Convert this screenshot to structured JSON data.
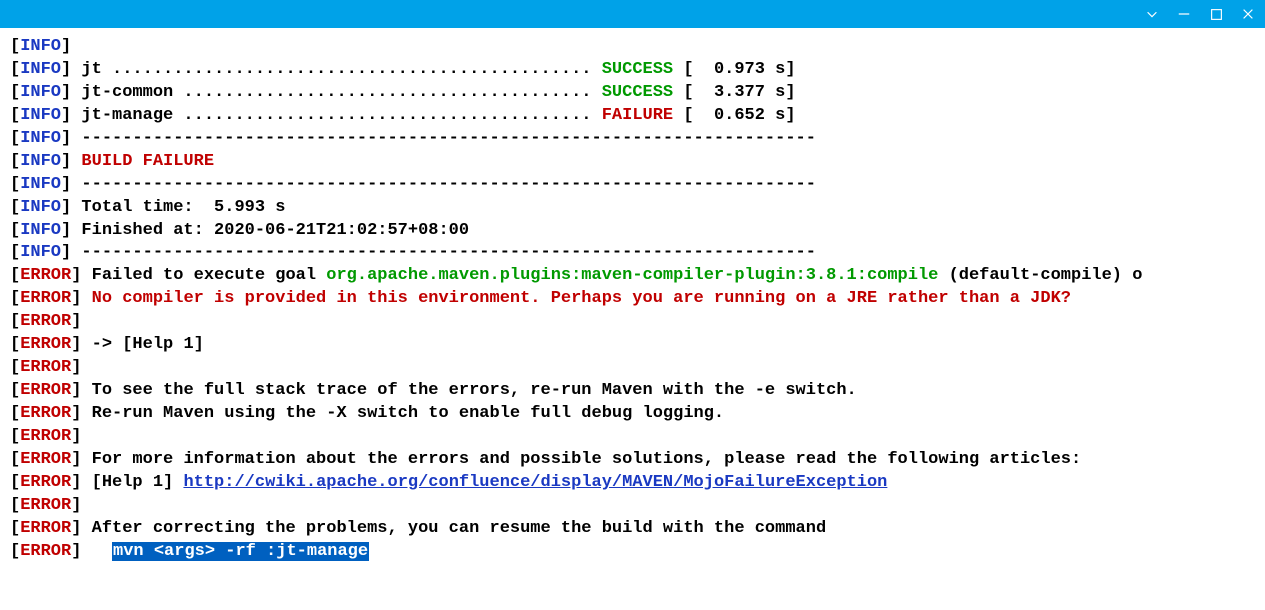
{
  "colors": {
    "titlebar_bg": "#00a2e8",
    "info": "#1a39c2",
    "error": "#c00000",
    "success": "#009900",
    "highlight_bg": "#0060c0"
  },
  "build": {
    "modules": [
      {
        "name": "jt",
        "status": "SUCCESS",
        "time": "0.973 s"
      },
      {
        "name": "jt-common",
        "status": "SUCCESS",
        "time": "3.377 s"
      },
      {
        "name": "jt-manage",
        "status": "FAILURE",
        "time": "0.652 s"
      }
    ],
    "result": "BUILD FAILURE",
    "total_time": "5.993 s",
    "finished_at": "2020-06-21T21:02:57+08:00"
  },
  "lines": [
    {
      "tag": "INFO",
      "parts": []
    },
    {
      "tag": "INFO",
      "parts": [
        {
          "t": " jt ............................................... ",
          "cls": "plain"
        },
        {
          "t": "SUCCESS",
          "cls": "green"
        },
        {
          "t": " [  0.973 s]",
          "cls": "plain"
        }
      ]
    },
    {
      "tag": "INFO",
      "parts": [
        {
          "t": " jt-common ........................................ ",
          "cls": "plain"
        },
        {
          "t": "SUCCESS",
          "cls": "green"
        },
        {
          "t": " [  3.377 s]",
          "cls": "plain"
        }
      ]
    },
    {
      "tag": "INFO",
      "parts": [
        {
          "t": " jt-manage ........................................ ",
          "cls": "plain"
        },
        {
          "t": "FAILURE",
          "cls": "red"
        },
        {
          "t": " [  0.652 s]",
          "cls": "plain"
        }
      ]
    },
    {
      "tag": "INFO",
      "parts": [
        {
          "t": " ------------------------------------------------------------------------",
          "cls": "plain bold"
        }
      ]
    },
    {
      "tag": "INFO",
      "parts": [
        {
          "t": " BUILD FAILURE",
          "cls": "red bold"
        }
      ]
    },
    {
      "tag": "INFO",
      "parts": [
        {
          "t": " ------------------------------------------------------------------------",
          "cls": "plain bold"
        }
      ]
    },
    {
      "tag": "INFO",
      "parts": [
        {
          "t": " Total time:  5.993 s",
          "cls": "plain"
        }
      ]
    },
    {
      "tag": "INFO",
      "parts": [
        {
          "t": " Finished at: 2020-06-21T21:02:57+08:00",
          "cls": "plain"
        }
      ]
    },
    {
      "tag": "INFO",
      "parts": [
        {
          "t": " ------------------------------------------------------------------------",
          "cls": "plain bold"
        }
      ]
    },
    {
      "tag": "ERROR",
      "parts": [
        {
          "t": " Failed to execute goal ",
          "cls": "plain"
        },
        {
          "t": "org.apache.maven.plugins:maven-compiler-plugin:3.8.1:compile",
          "cls": "green"
        },
        {
          "t": " ",
          "cls": "plain"
        },
        {
          "t": "(default-compile)",
          "cls": "plain bold"
        },
        {
          "t": " o",
          "cls": "plain"
        }
      ]
    },
    {
      "tag": "ERROR",
      "parts": [
        {
          "t": " No compiler is provided in this environment. Perhaps you are running on a JRE rather than a JDK?",
          "cls": "red bold"
        }
      ]
    },
    {
      "tag": "ERROR",
      "parts": []
    },
    {
      "tag": "ERROR",
      "parts": [
        {
          "t": " -> ",
          "cls": "plain"
        },
        {
          "t": "[Help 1]",
          "cls": "plain bold"
        }
      ]
    },
    {
      "tag": "ERROR",
      "parts": []
    },
    {
      "tag": "ERROR",
      "parts": [
        {
          "t": " To see the full stack trace of the errors, re-run Maven with the ",
          "cls": "plain"
        },
        {
          "t": "-e",
          "cls": "plain bold"
        },
        {
          "t": " switch.",
          "cls": "plain"
        }
      ]
    },
    {
      "tag": "ERROR",
      "parts": [
        {
          "t": " Re-run Maven using the ",
          "cls": "plain"
        },
        {
          "t": "-X",
          "cls": "plain bold"
        },
        {
          "t": " switch to enable full debug logging.",
          "cls": "plain"
        }
      ]
    },
    {
      "tag": "ERROR",
      "parts": []
    },
    {
      "tag": "ERROR",
      "parts": [
        {
          "t": " For more information about the errors and possible solutions, please read the following articles:",
          "cls": "plain"
        }
      ]
    },
    {
      "tag": "ERROR",
      "parts": [
        {
          "t": " ",
          "cls": "plain"
        },
        {
          "t": "[Help 1]",
          "cls": "plain bold"
        },
        {
          "t": " ",
          "cls": "plain"
        },
        {
          "t": "http://cwiki.apache.org/confluence/display/MAVEN/MojoFailureException",
          "cls": "link"
        }
      ]
    },
    {
      "tag": "ERROR",
      "parts": []
    },
    {
      "tag": "ERROR",
      "parts": [
        {
          "t": " After correcting the problems, you can resume the build with the command",
          "cls": "plain"
        }
      ]
    },
    {
      "tag": "ERROR",
      "parts": [
        {
          "t": "   ",
          "cls": "plain"
        },
        {
          "t": "mvn <args> -rf :jt-manage",
          "cls": "hl"
        }
      ]
    }
  ]
}
